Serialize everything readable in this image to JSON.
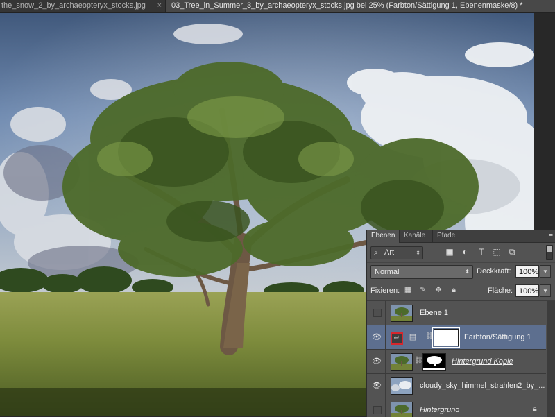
{
  "document_tabs": [
    {
      "label": "the_snow_2_by_archaeopteryx_stocks.jpg",
      "close": "×",
      "active": false
    },
    {
      "label": "03_Tree_in_Summer_3_by_archaeopteryx_stocks.jpg bei 25% (Farbton/Sättigung 1, Ebenenmaske/8) *",
      "active": true
    }
  ],
  "layers_panel": {
    "tabs": [
      "Ebenen",
      "Kanäle",
      "Pfade"
    ],
    "active_tab": "Ebenen",
    "filter": {
      "kind_label": "Art"
    },
    "blend_mode": "Normal",
    "opacity": {
      "label": "Deckkraft:",
      "value": "100%"
    },
    "lock": {
      "label": "Fixieren:"
    },
    "fill": {
      "label": "Fläche:",
      "value": "100%"
    },
    "layers": [
      {
        "name": "Ebene 1",
        "visible": false,
        "selected": false
      },
      {
        "name": "Farbton/Sättigung 1",
        "visible": true,
        "selected": true,
        "type": "adjustment"
      },
      {
        "name": "Hintergrund Kopie",
        "visible": true,
        "selected": false
      },
      {
        "name": "cloudy_sky_himmel_strahlen2_by_...",
        "visible": true,
        "selected": false
      },
      {
        "name": "Hintergrund",
        "visible": false,
        "selected": false,
        "locked": true
      }
    ]
  },
  "colors": {
    "selected_layer": "#5d6f8f",
    "panel_bg": "#535353",
    "adjustment_highlight": "#d7262c"
  },
  "icons": [
    "close-icon",
    "search-icon",
    "image-filter-icon",
    "adjustment-filter-icon",
    "type-filter-icon",
    "shape-filter-icon",
    "smart-object-filter-icon",
    "lock-transparent-icon",
    "lock-paint-icon",
    "lock-position-icon",
    "lock-all-icon",
    "eye-icon",
    "link-icon",
    "lock-icon",
    "panel-menu-icon"
  ]
}
